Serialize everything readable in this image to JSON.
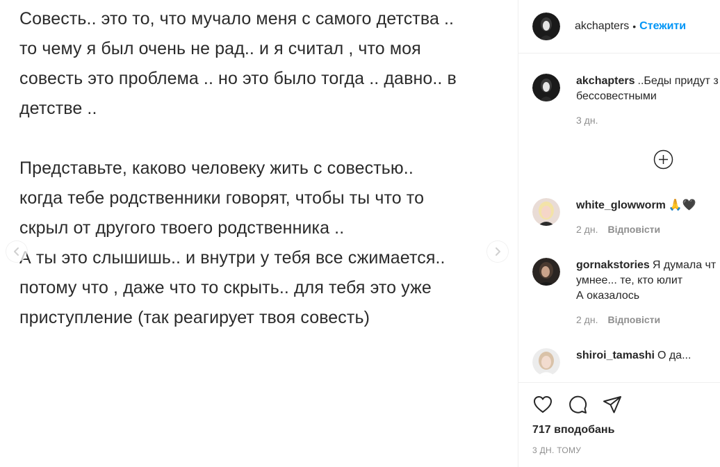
{
  "post": {
    "paragraphs": [
      [
        "Совесть.. это то, что мучало меня с самого детства ..",
        "то чему я был очень не рад.. и я считал , что моя",
        "совесть это проблема .. но это было тогда .. давно.. в",
        "детстве .."
      ],
      [
        "Представьте, каково человеку жить с совестью..",
        "когда тебе родственники говорят, чтобы ты что то",
        "скрыл от другого твоего родственника ..",
        "А ты это слышишь.. и внутри у тебя все сжимается..",
        "потому что , даже что то скрыть.. для тебя это уже",
        "приступление (так реагирует твоя совесть)"
      ]
    ]
  },
  "header": {
    "username": "akchapters",
    "separator": "•",
    "follow_label": "Стежити"
  },
  "caption": {
    "username": "akchapters",
    "text_line1": "..Беды придут з",
    "text_line2": "бессовестными",
    "time": "3 дн."
  },
  "comments": [
    {
      "username": "white_glowworm",
      "text": "🙏🖤",
      "time": "2 дн.",
      "reply": "Відповісти"
    },
    {
      "username": "gornakstories",
      "text_line1": "Я думала чт",
      "text_line2": "умнее... те, кто юлит",
      "text_line3": "А оказалось",
      "time": "2 дн.",
      "reply": "Відповісти"
    },
    {
      "username": "shiroi_tamashi",
      "text": "О да..."
    }
  ],
  "footer": {
    "likes": "717 вподобань",
    "time_ago": "3 ДН. ТОМУ"
  },
  "colors": {
    "accent": "#0095f6",
    "muted": "#8e8e8e",
    "text": "#262626"
  }
}
